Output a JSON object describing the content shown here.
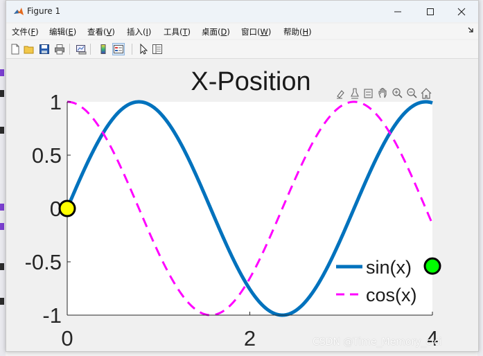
{
  "window": {
    "title": "Figure 1",
    "controls": {
      "minimize": "—",
      "maximize": "☐",
      "close": "✕"
    }
  },
  "menubar": {
    "items": [
      {
        "label": "文件(",
        "key": "F",
        "tail": ")"
      },
      {
        "label": "编辑(",
        "key": "E",
        "tail": ")"
      },
      {
        "label": "查看(",
        "key": "V",
        "tail": ")"
      },
      {
        "label": "插入(",
        "key": "I",
        "tail": ")"
      },
      {
        "label": "工具(",
        "key": "T",
        "tail": ")"
      },
      {
        "label": "桌面(",
        "key": "D",
        "tail": ")"
      },
      {
        "label": "窗口(",
        "key": "W",
        "tail": ")"
      },
      {
        "label": "帮助(",
        "key": "H",
        "tail": ")"
      }
    ],
    "dock_icon": "dock-arrow-icon"
  },
  "toolbar": {
    "icons": [
      "new-figure-icon",
      "open-file-icon",
      "save-icon",
      "print-icon",
      "link-plot-icon",
      "colorbar-icon",
      "legend-icon",
      "pointer-icon",
      "property-inspector-icon"
    ],
    "active": "legend-icon"
  },
  "axes_toolbar": {
    "icons": [
      "brush-icon",
      "data-tips-icon",
      "restore-view-icon",
      "pan-icon",
      "zoom-in-icon",
      "zoom-out-icon",
      "home-icon"
    ]
  },
  "chart_data": {
    "type": "line",
    "title": "X-Position",
    "xlabel": "",
    "ylabel": "",
    "xlim": [
      0,
      4
    ],
    "ylim": [
      -1,
      1
    ],
    "xticks": [
      0,
      2,
      4
    ],
    "xtick_labels": [
      "0",
      "2",
      "4"
    ],
    "yticks": [
      1,
      0.5,
      0,
      -0.5,
      -1
    ],
    "ytick_labels": [
      "1",
      "0.5",
      "0",
      "-0.5",
      "-1"
    ],
    "grid": false,
    "legend_position": "bottom-right",
    "series": [
      {
        "name": "sin(x)",
        "function": "sin",
        "frequency": 2.0,
        "style": "solid",
        "color": "#0072bd",
        "width": 5
      },
      {
        "name": "cos(x)",
        "function": "cos",
        "frequency": 2.0,
        "style": "dashed",
        "color": "#ff00ff",
        "width": 3
      }
    ],
    "markers": [
      {
        "x": 0,
        "y": 0,
        "color": "#ffff00"
      },
      {
        "x": 4,
        "y": -0.54,
        "color": "#00ff00"
      }
    ]
  },
  "watermark": "CSDN @Time_Memory_cici"
}
